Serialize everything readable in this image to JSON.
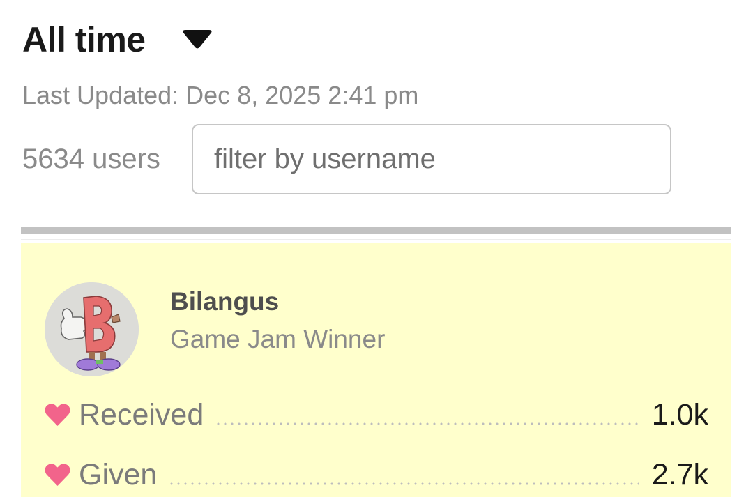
{
  "header": {
    "period_label": "All time",
    "last_updated": "Last Updated: Dec 8, 2025 2:41 pm"
  },
  "filter": {
    "user_count": "5634 users",
    "placeholder": "filter by username",
    "value": ""
  },
  "user": {
    "name": "Bilangus",
    "title": "Game Jam Winner",
    "avatar_letter": "B",
    "stats": [
      {
        "label": "Received",
        "value": "1.0k"
      },
      {
        "label": "Given",
        "value": "2.7k"
      }
    ]
  },
  "colors": {
    "card_background": "#ffffcc",
    "heart": "#f2648b",
    "divider": "#c2c2c2"
  }
}
